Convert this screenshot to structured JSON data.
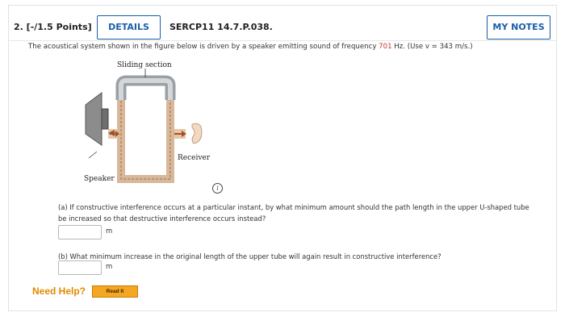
{
  "header": {
    "question_label": "2. [-/1.5 Points]",
    "details_label": "DETAILS",
    "question_code": "SERCP11 14.7.P.038.",
    "my_notes_label": "MY NOTES"
  },
  "prompt": {
    "before": "The acoustical system shown in the figure below is driven by a speaker emitting sound of frequency ",
    "frequency": "701",
    "after": " Hz. (Use v = 343 m/s.)"
  },
  "figure": {
    "sliding_section_label": "Sliding section",
    "receiver_label": "Receiver",
    "speaker_label": "Speaker",
    "info_icon_glyph": "i"
  },
  "part_a": {
    "text": "(a) If constructive interference occurs at a particular instant, by what minimum amount should the path length in the upper U-shaped tube be increased so that destructive interference occurs instead?",
    "value": "",
    "unit": "m"
  },
  "part_b": {
    "text": "(b) What minimum increase in the original length of the upper tube will again result in constructive interference?",
    "value": "",
    "unit": "m"
  },
  "help": {
    "need_help_label": "Need Help?",
    "read_it_label": "Read It"
  },
  "colors": {
    "accent": "#1a5ea8",
    "frequency": "#c0392b",
    "help": "#e08a00",
    "read_it_button": "#f5a623"
  }
}
